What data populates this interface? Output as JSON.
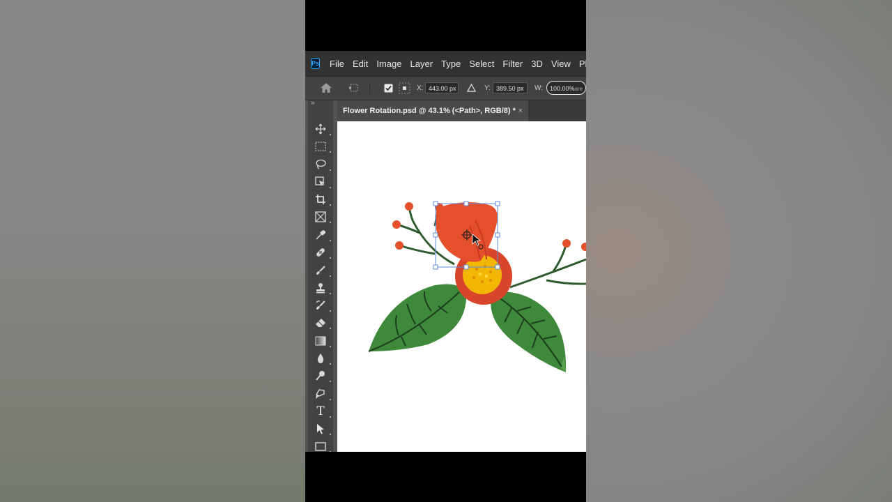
{
  "menu": {
    "logo": "Ps",
    "items": [
      "File",
      "Edit",
      "Image",
      "Layer",
      "Type",
      "Select",
      "Filter",
      "3D",
      "View",
      "Plu"
    ]
  },
  "options": {
    "x_label": "X:",
    "x_value": "443.00 px",
    "y_label": "Y:",
    "y_value": "389.50 px",
    "w_label": "W:",
    "w_value": "100.00%",
    "w_suffix": "are"
  },
  "document": {
    "tab_title": "Flower Rotation.psd @ 43.1% (<Path>, RGB/8) *",
    "close_glyph": "×"
  },
  "toolbar": {
    "collapse_glyph": "»",
    "tools": [
      "move-tool-icon",
      "marquee-tool-icon",
      "lasso-tool-icon",
      "object-select-tool-icon",
      "crop-tool-icon",
      "frame-tool-icon",
      "eyedropper-tool-icon",
      "healing-brush-tool-icon",
      "brush-tool-icon",
      "clone-stamp-tool-icon",
      "history-brush-tool-icon",
      "eraser-tool-icon",
      "gradient-tool-icon",
      "blur-tool-icon",
      "dodge-tool-icon",
      "pen-tool-icon",
      "type-tool-icon",
      "path-select-tool-icon",
      "rectangle-tool-icon"
    ],
    "type_glyph": "T"
  },
  "colors": {
    "petal": "#e4502b",
    "center": "#f2b705",
    "leaf": "#3f8a3a",
    "stem": "#2f5b2e",
    "berry": "#e4502b",
    "selection": "#5b8bd8"
  }
}
